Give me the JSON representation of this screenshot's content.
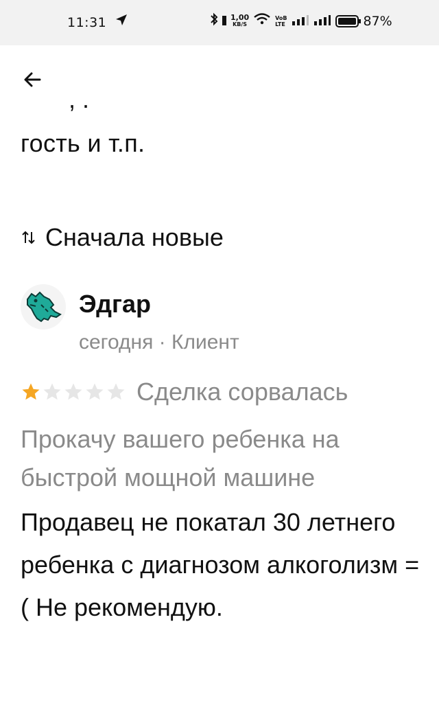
{
  "status_bar": {
    "time": "11:31",
    "speed_value": "1,00",
    "speed_unit": "KB/S",
    "volte_top": "VoB",
    "volte_bottom": "LTE",
    "battery_percent": "87%"
  },
  "content": {
    "clipped_line": ", .",
    "truncated_text": "гость и т.п.",
    "sort_label": "Сначала новые"
  },
  "review": {
    "author": "Эдгар",
    "meta": "сегодня · Клиент",
    "rating": 1,
    "rating_max": 5,
    "deal_status": "Сделка сорвалась",
    "ad_title": "Прокачу вашего ребенка на быстрой мощной машине",
    "text": "Продавец не покатал 30 летнего ребенка с диагнозом алкоголизм =( Не рекомендую."
  },
  "colors": {
    "star_filled": "#f5a623",
    "star_empty": "#e6e6e6",
    "secondary_text": "#8a8a8a",
    "avatar_dino": "#1faa99"
  }
}
